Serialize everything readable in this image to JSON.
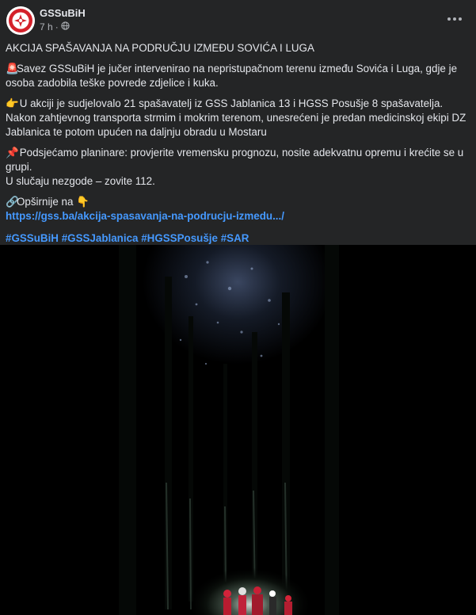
{
  "post": {
    "author": "GSSuBiH",
    "time": "7 h",
    "separator": "·",
    "privacy_icon": "globe-icon",
    "more_icon": "more-options-icon",
    "title": "AKCIJA SPAŠAVANJA NA PODRUČJU IZMEĐU SOVIĆA I LUGA",
    "para1_emoji": "🚨",
    "para1": "Savez GSSuBiH je jučer intervenirao na nepristupačnom terenu između Sovića i Luga, gdje je osoba zadobila teške povrede zdjelice i kuka.",
    "para2_emoji": "👉",
    "para2": " U akciji je sudjelovalo 21 spašavatelj iz   GSS Jablanica 13  i HGSS Posušje 8 spašavatelja. Nakon zahtjevnog transporta strmim i mokrim terenom, unesrećeni je predan medicinskoj ekipi DZ Jablanica te potom upućen na daljnju obradu u Mostaru",
    "para3_emoji": "📌",
    "para3_line1": " Podsjećamo planinare: provjerite vremensku prognozu, nosite adekvatnu opremu i krećite se u grupi.",
    "para3_line2": "U slučaju nezgode – zovite 112.",
    "more_emoji_left": "🔗",
    "more_label": "Opširnije na ",
    "more_emoji_right": "👇",
    "link_url": "https://gss.ba/akcija-spasavanja-na-podrucju-izmedu.../",
    "hashtags": [
      "#GSSuBiH",
      "#GSSJablanica",
      "#HGSSPosušje",
      "#SAR"
    ]
  },
  "photo": {
    "subject": "night rescue in forest"
  },
  "colors": {
    "background": "#242526",
    "text": "#e4e6eb",
    "secondary": "#b0b3b8",
    "link": "#4599ff",
    "logo_red": "#d4212a"
  }
}
